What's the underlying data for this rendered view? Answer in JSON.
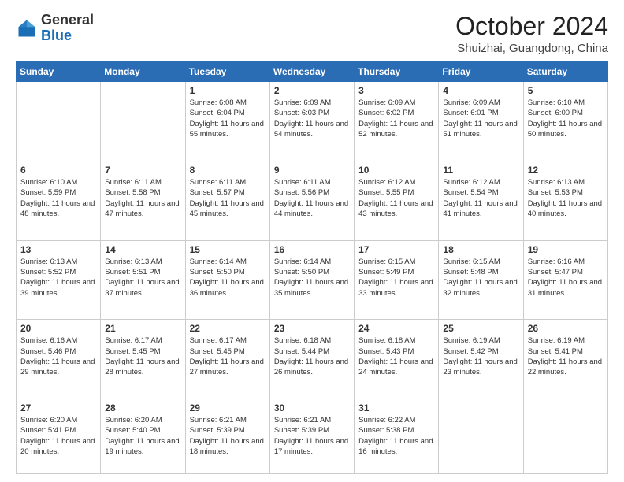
{
  "header": {
    "logo_general": "General",
    "logo_blue": "Blue",
    "month": "October 2024",
    "location": "Shuizhai, Guangdong, China"
  },
  "weekdays": [
    "Sunday",
    "Monday",
    "Tuesday",
    "Wednesday",
    "Thursday",
    "Friday",
    "Saturday"
  ],
  "weeks": [
    [
      {
        "day": "",
        "info": ""
      },
      {
        "day": "",
        "info": ""
      },
      {
        "day": "1",
        "info": "Sunrise: 6:08 AM\nSunset: 6:04 PM\nDaylight: 11 hours and 55 minutes."
      },
      {
        "day": "2",
        "info": "Sunrise: 6:09 AM\nSunset: 6:03 PM\nDaylight: 11 hours and 54 minutes."
      },
      {
        "day": "3",
        "info": "Sunrise: 6:09 AM\nSunset: 6:02 PM\nDaylight: 11 hours and 52 minutes."
      },
      {
        "day": "4",
        "info": "Sunrise: 6:09 AM\nSunset: 6:01 PM\nDaylight: 11 hours and 51 minutes."
      },
      {
        "day": "5",
        "info": "Sunrise: 6:10 AM\nSunset: 6:00 PM\nDaylight: 11 hours and 50 minutes."
      }
    ],
    [
      {
        "day": "6",
        "info": "Sunrise: 6:10 AM\nSunset: 5:59 PM\nDaylight: 11 hours and 48 minutes."
      },
      {
        "day": "7",
        "info": "Sunrise: 6:11 AM\nSunset: 5:58 PM\nDaylight: 11 hours and 47 minutes."
      },
      {
        "day": "8",
        "info": "Sunrise: 6:11 AM\nSunset: 5:57 PM\nDaylight: 11 hours and 45 minutes."
      },
      {
        "day": "9",
        "info": "Sunrise: 6:11 AM\nSunset: 5:56 PM\nDaylight: 11 hours and 44 minutes."
      },
      {
        "day": "10",
        "info": "Sunrise: 6:12 AM\nSunset: 5:55 PM\nDaylight: 11 hours and 43 minutes."
      },
      {
        "day": "11",
        "info": "Sunrise: 6:12 AM\nSunset: 5:54 PM\nDaylight: 11 hours and 41 minutes."
      },
      {
        "day": "12",
        "info": "Sunrise: 6:13 AM\nSunset: 5:53 PM\nDaylight: 11 hours and 40 minutes."
      }
    ],
    [
      {
        "day": "13",
        "info": "Sunrise: 6:13 AM\nSunset: 5:52 PM\nDaylight: 11 hours and 39 minutes."
      },
      {
        "day": "14",
        "info": "Sunrise: 6:13 AM\nSunset: 5:51 PM\nDaylight: 11 hours and 37 minutes."
      },
      {
        "day": "15",
        "info": "Sunrise: 6:14 AM\nSunset: 5:50 PM\nDaylight: 11 hours and 36 minutes."
      },
      {
        "day": "16",
        "info": "Sunrise: 6:14 AM\nSunset: 5:50 PM\nDaylight: 11 hours and 35 minutes."
      },
      {
        "day": "17",
        "info": "Sunrise: 6:15 AM\nSunset: 5:49 PM\nDaylight: 11 hours and 33 minutes."
      },
      {
        "day": "18",
        "info": "Sunrise: 6:15 AM\nSunset: 5:48 PM\nDaylight: 11 hours and 32 minutes."
      },
      {
        "day": "19",
        "info": "Sunrise: 6:16 AM\nSunset: 5:47 PM\nDaylight: 11 hours and 31 minutes."
      }
    ],
    [
      {
        "day": "20",
        "info": "Sunrise: 6:16 AM\nSunset: 5:46 PM\nDaylight: 11 hours and 29 minutes."
      },
      {
        "day": "21",
        "info": "Sunrise: 6:17 AM\nSunset: 5:45 PM\nDaylight: 11 hours and 28 minutes."
      },
      {
        "day": "22",
        "info": "Sunrise: 6:17 AM\nSunset: 5:45 PM\nDaylight: 11 hours and 27 minutes."
      },
      {
        "day": "23",
        "info": "Sunrise: 6:18 AM\nSunset: 5:44 PM\nDaylight: 11 hours and 26 minutes."
      },
      {
        "day": "24",
        "info": "Sunrise: 6:18 AM\nSunset: 5:43 PM\nDaylight: 11 hours and 24 minutes."
      },
      {
        "day": "25",
        "info": "Sunrise: 6:19 AM\nSunset: 5:42 PM\nDaylight: 11 hours and 23 minutes."
      },
      {
        "day": "26",
        "info": "Sunrise: 6:19 AM\nSunset: 5:41 PM\nDaylight: 11 hours and 22 minutes."
      }
    ],
    [
      {
        "day": "27",
        "info": "Sunrise: 6:20 AM\nSunset: 5:41 PM\nDaylight: 11 hours and 20 minutes."
      },
      {
        "day": "28",
        "info": "Sunrise: 6:20 AM\nSunset: 5:40 PM\nDaylight: 11 hours and 19 minutes."
      },
      {
        "day": "29",
        "info": "Sunrise: 6:21 AM\nSunset: 5:39 PM\nDaylight: 11 hours and 18 minutes."
      },
      {
        "day": "30",
        "info": "Sunrise: 6:21 AM\nSunset: 5:39 PM\nDaylight: 11 hours and 17 minutes."
      },
      {
        "day": "31",
        "info": "Sunrise: 6:22 AM\nSunset: 5:38 PM\nDaylight: 11 hours and 16 minutes."
      },
      {
        "day": "",
        "info": ""
      },
      {
        "day": "",
        "info": ""
      }
    ]
  ]
}
